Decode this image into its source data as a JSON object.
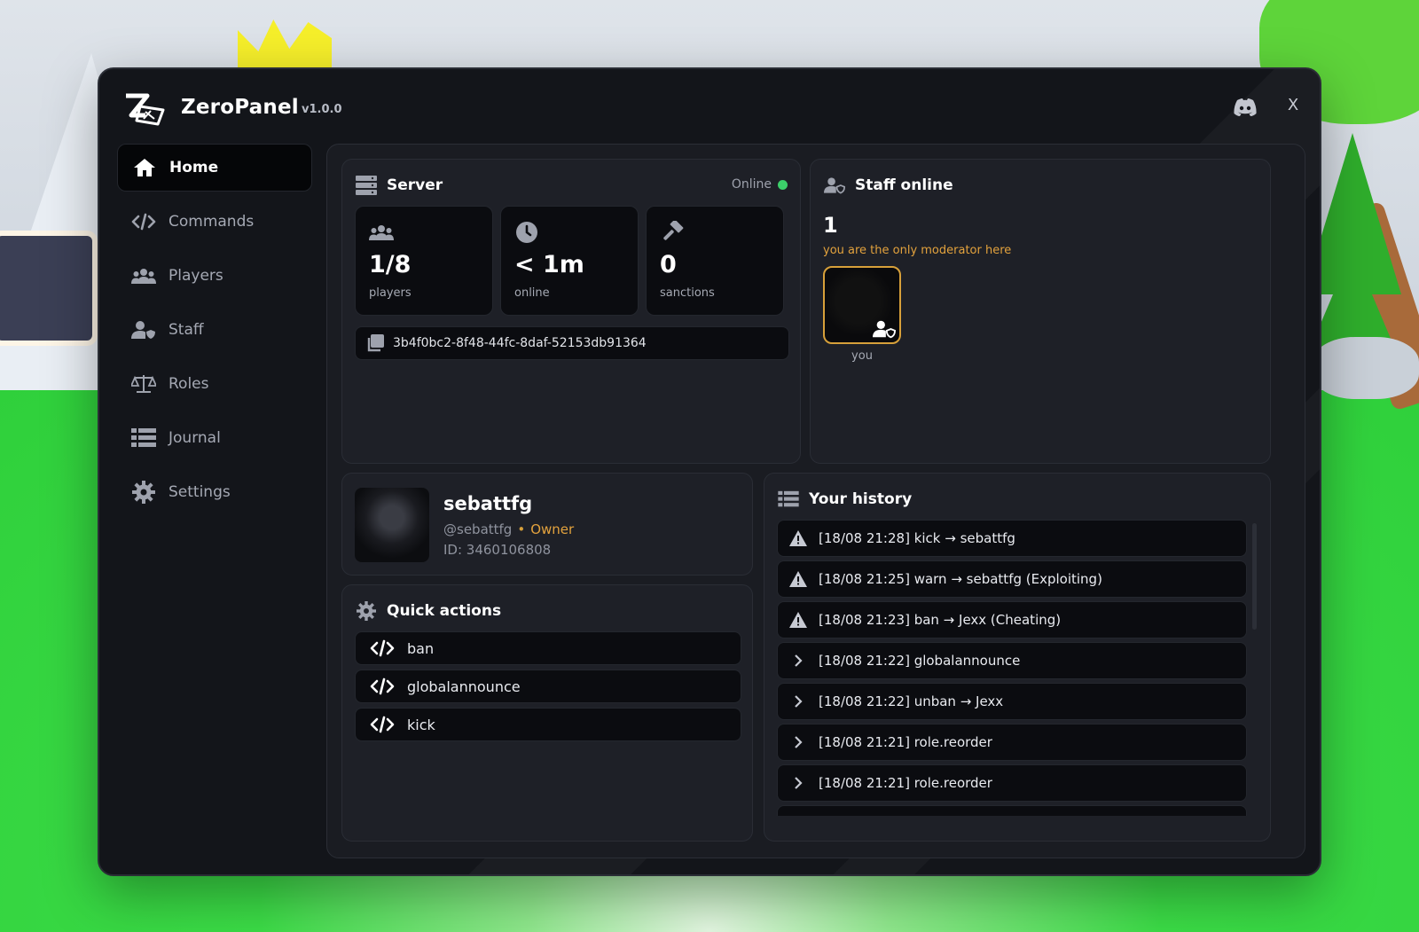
{
  "app": {
    "title": "ZeroPanel",
    "version": "v1.0.0",
    "close_label": "X"
  },
  "sidebar": {
    "items": [
      {
        "label": "Home",
        "icon": "home-icon",
        "active": true
      },
      {
        "label": "Commands",
        "icon": "code-icon",
        "active": false
      },
      {
        "label": "Players",
        "icon": "users-icon",
        "active": false
      },
      {
        "label": "Staff",
        "icon": "staff-icon",
        "active": false
      },
      {
        "label": "Roles",
        "icon": "scale-icon",
        "active": false
      },
      {
        "label": "Journal",
        "icon": "list-icon",
        "active": false
      },
      {
        "label": "Settings",
        "icon": "gear-icon",
        "active": false
      }
    ]
  },
  "server": {
    "title": "Server",
    "status": "Online",
    "stats": [
      {
        "value": "1/8",
        "label": "players",
        "icon": "users-icon"
      },
      {
        "value": "< 1m",
        "label": "online",
        "icon": "clock-icon"
      },
      {
        "value": "0",
        "label": "sanctions",
        "icon": "hammer-icon"
      }
    ],
    "server_id": "3b4f0bc2-8f48-44fc-8daf-52153db91364"
  },
  "staff": {
    "title": "Staff online",
    "count": "1",
    "note": "you are the only moderator here",
    "members": [
      {
        "name": "you"
      }
    ]
  },
  "profile": {
    "display_name": "sebattfg",
    "handle": "@sebattfg",
    "separator": "•",
    "role": "Owner",
    "user_id": "ID: 3460106808"
  },
  "quick_actions": {
    "title": "Quick actions",
    "items": [
      "ban",
      "globalannounce",
      "kick"
    ]
  },
  "history": {
    "title": "Your history",
    "items": [
      {
        "text": "[18/08 21:28] kick → sebattfg",
        "icon": "warning-icon"
      },
      {
        "text": "[18/08 21:25] warn → sebattfg  (Exploiting)",
        "icon": "warning-icon"
      },
      {
        "text": "[18/08 21:23] ban → Jexx  (Cheating)",
        "icon": "warning-icon"
      },
      {
        "text": "[18/08 21:22] globalannounce",
        "icon": "chevron-right-icon"
      },
      {
        "text": "[18/08 21:22] unban → Jexx",
        "icon": "chevron-right-icon"
      },
      {
        "text": "[18/08 21:21] role.reorder",
        "icon": "chevron-right-icon"
      },
      {
        "text": "[18/08 21:21] role.reorder",
        "icon": "chevron-right-icon"
      },
      {
        "text": "",
        "icon": "chevron-right-icon"
      }
    ]
  },
  "colors": {
    "accent_gold": "#d7a03a",
    "status_online": "#3ccf6a",
    "window_bg": "#13151a"
  }
}
